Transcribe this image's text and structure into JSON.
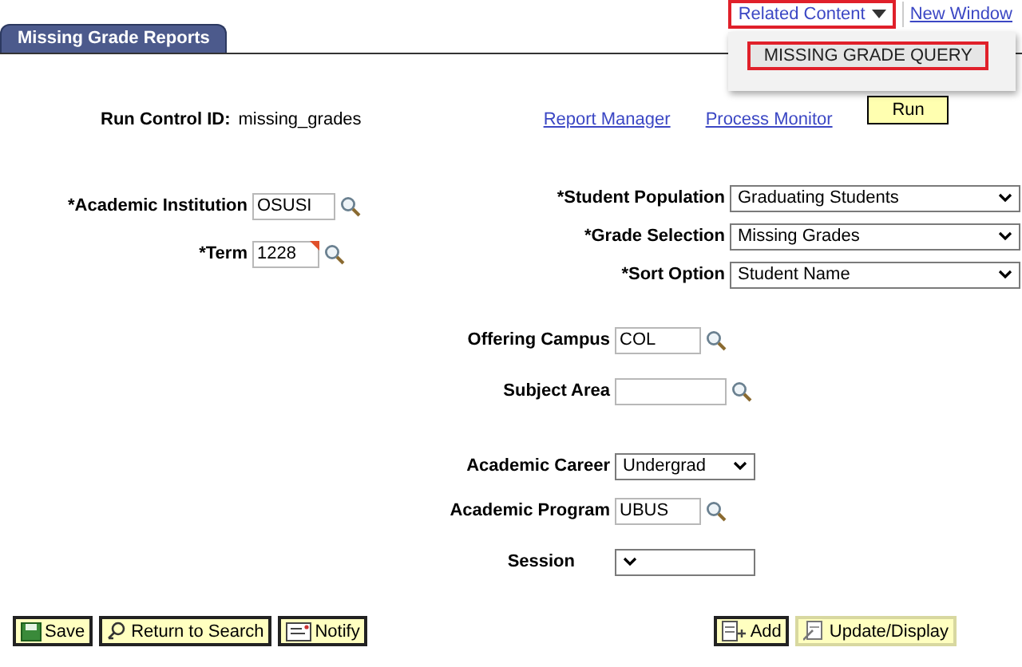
{
  "header": {
    "related_content": {
      "label": "Related Content",
      "expanded": true
    },
    "new_window": "New Window",
    "menu_items": [
      {
        "label": "MISSING GRADE QUERY",
        "selected": true
      }
    ]
  },
  "tabs": [
    {
      "label": "Missing Grade Reports",
      "selected": true
    }
  ],
  "run_control": {
    "label": "Run Control ID:",
    "value": "missing_grades"
  },
  "links": [
    "Report Manager",
    "Process Monitor"
  ],
  "run_button": "Run",
  "left_fields": [
    {
      "kind": "prompt",
      "label": "*Academic Institution",
      "value": "OSUSI",
      "flagged": false
    },
    {
      "kind": "prompt",
      "label": "*Term",
      "value": "1228",
      "flagged": true
    }
  ],
  "right_fields": [
    {
      "kind": "select",
      "label": "*Student Population",
      "value": "Graduating Students"
    },
    {
      "kind": "select",
      "label": "*Grade Selection",
      "value": "Missing Grades"
    },
    {
      "kind": "select",
      "label": "*Sort Option",
      "value": "Student Name"
    }
  ],
  "lower_fields": [
    {
      "kind": "prompt",
      "label": "Offering Campus",
      "value": "COL",
      "flagged": false
    },
    {
      "kind": "prompt",
      "label": "Subject Area",
      "flagged": false
    },
    {
      "kind": "select",
      "label": "Academic Career",
      "value": "Undergrad"
    },
    {
      "kind": "prompt",
      "label": "Academic Program",
      "value": "UBUS",
      "flagged": false
    },
    {
      "kind": "select",
      "label": "Session"
    }
  ],
  "footer_left": [
    {
      "kind": "save",
      "label": "Save",
      "selected": false
    },
    {
      "kind": "search",
      "label": "Return to Search",
      "selected": false
    },
    {
      "kind": "notify",
      "label": "Notify",
      "selected": false
    }
  ],
  "footer_right": [
    {
      "kind": "add",
      "label": "Add",
      "selected": false
    },
    {
      "kind": "update",
      "label": "Update/Display",
      "selected": true
    }
  ]
}
